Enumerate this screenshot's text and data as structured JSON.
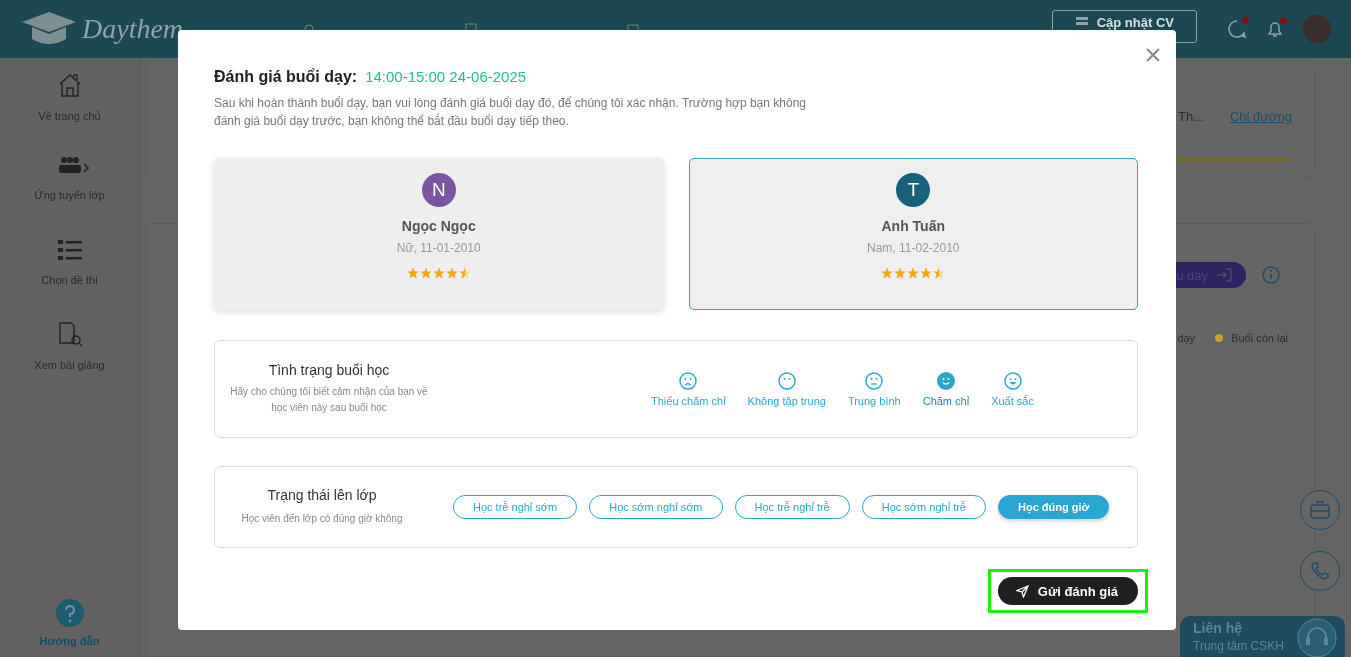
{
  "header": {
    "logo": "Daythem",
    "update_cv_button": "Cập nhật CV"
  },
  "sidebar": {
    "items": [
      {
        "label": "Về trang chủ"
      },
      {
        "label": "Ứng tuyển lớp"
      },
      {
        "label": "Chọn đề thi"
      },
      {
        "label": "Xem bài giảng"
      }
    ],
    "help": "Hướng dẫn"
  },
  "background": {
    "address": "Th...",
    "directions_link": "Chỉ đường",
    "start_button": "u dạy",
    "legend": [
      {
        "label": "dạy"
      },
      {
        "label": "Buổi còn lại",
        "color": "#c9a227"
      }
    ]
  },
  "contact": {
    "title": "Liên hệ",
    "subtitle": "Trung tâm CSKH"
  },
  "modal": {
    "title": "Đánh giá buổi dạy:",
    "session_time": "14:00-15:00 24-06-2025",
    "description": "Sau khi hoàn thành buổi dạy, bạn vui lòng đánh giá buổi dạy đó, để chúng tôi xác nhận. Trường hợp bạn không đánh giá buổi dạy trước, bạn không thể bắt đầu buổi dạy tiếp theo.",
    "students": [
      {
        "initial": "N",
        "name": "Ngọc Ngọc",
        "info": "Nữ, 11-01-2010",
        "stars": 4.5,
        "color": "#7b55a3",
        "selected": false
      },
      {
        "initial": "T",
        "name": "Anh Tuấn",
        "info": "Nam, 11-02-2010",
        "stars": 4.5,
        "color": "#17627a",
        "selected": true
      }
    ],
    "condition": {
      "title": "Tình trạng buổi học",
      "hint": "Hãy cho chúng tôi biết cảm nhận của bạn về học viên này sau buổi học",
      "options": [
        {
          "label": "Thiếu chăm chỉ",
          "selected": false
        },
        {
          "label": "Không tập trung",
          "selected": false
        },
        {
          "label": "Trung bình",
          "selected": false
        },
        {
          "label": "Chăm chỉ",
          "selected": true
        },
        {
          "label": "Xuất sắc",
          "selected": false
        }
      ]
    },
    "attendance": {
      "title": "Trạng thái lên lớp",
      "hint": "Học viên đến lớp có đúng giờ không",
      "options": [
        {
          "label": "Học trễ nghỉ sớm",
          "selected": false
        },
        {
          "label": "Học sớm nghỉ sớm",
          "selected": false
        },
        {
          "label": "Học trễ nghỉ trễ",
          "selected": false
        },
        {
          "label": "Học sớm nghỉ trễ",
          "selected": false
        },
        {
          "label": "Học đúng giờ",
          "selected": true
        }
      ]
    },
    "submit_button": "Gửi đánh giá"
  }
}
